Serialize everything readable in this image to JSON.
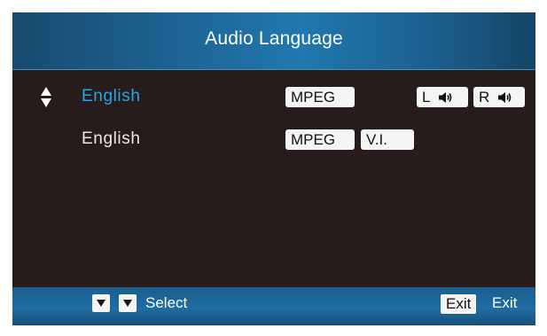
{
  "header": {
    "title": "Audio Language"
  },
  "rows": [
    {
      "language": "English",
      "codec": "MPEG",
      "left_channel": "L",
      "right_channel": "R",
      "selected": true
    },
    {
      "language": "English",
      "codec": "MPEG",
      "tag": "V.I.",
      "selected": false
    }
  ],
  "footer": {
    "select_label": "Select",
    "exit_key": "Exit",
    "exit_label": "Exit"
  },
  "icons": {
    "selector": "up-down-arrows-icon",
    "speaker": "speaker-icon",
    "nav": "down-arrow-icon"
  },
  "colors": {
    "selected_text": "#2aa4e2",
    "panel_background": "#261c1b",
    "header_blue": "#2178ae"
  }
}
